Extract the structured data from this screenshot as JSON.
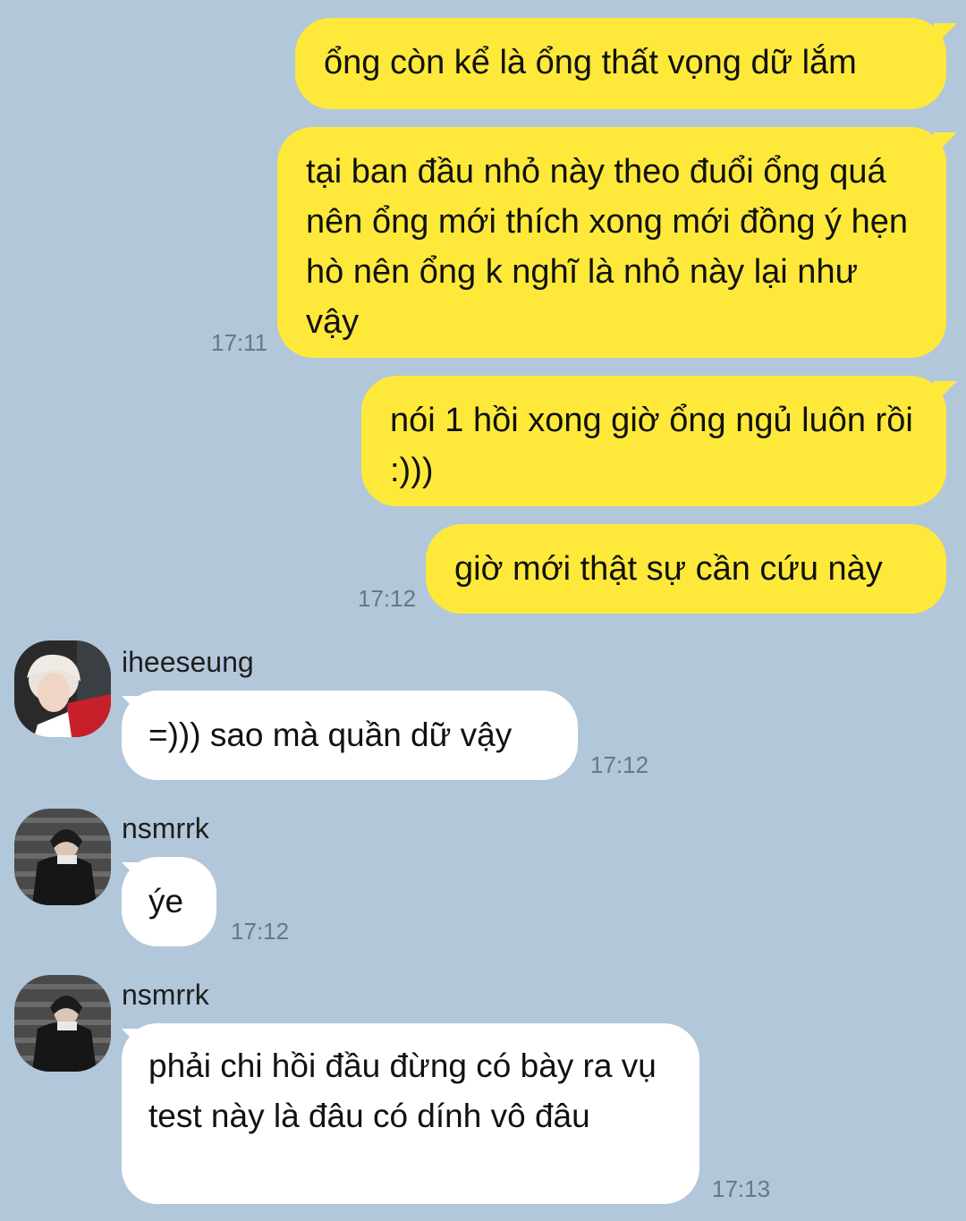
{
  "messages": [
    {
      "text": "ổng còn kể là ổng thất vọng dữ lắm"
    },
    {
      "text": "tại ban đầu nhỏ này theo đuổi ổng quá nên ổng mới thích xong mới đồng ý hẹn hò nên ổng k nghĩ là nhỏ này lại như vậy",
      "time": "17:11"
    },
    {
      "text": "nói 1 hồi xong giờ ổng ngủ luôn rồi :)))"
    },
    {
      "text": "giờ mới thật sự cần cứu này",
      "time": "17:12"
    },
    {
      "sender": "iheeseung",
      "text": "=))) sao mà quần dữ vậy",
      "time": "17:12"
    },
    {
      "sender": "nsmrrk",
      "text": "ýe",
      "time": "17:12"
    },
    {
      "sender": "nsmrrk",
      "text": "phải chi hồi đầu đừng có bày ra vụ test này là đâu có dính vô đâu",
      "time": "17:13"
    }
  ],
  "colors": {
    "background": "#b2c7da",
    "outgoing_bubble": "#fee93a",
    "incoming_bubble": "#ffffff",
    "timestamp": "#6b7782"
  },
  "icons": [
    "avatar-iheeseung",
    "avatar-nsmrrk"
  ]
}
